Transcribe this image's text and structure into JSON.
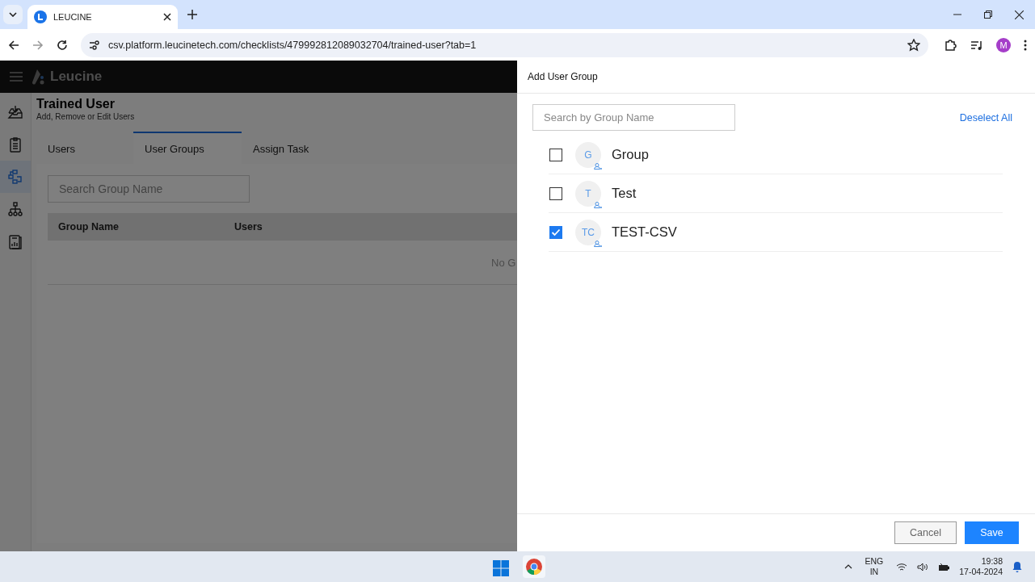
{
  "browser": {
    "tab_title": "LEUCINE",
    "url": "csv.platform.leucinetech.com/checklists/479992812089032704/trained-user?tab=1",
    "profile": "M"
  },
  "app": {
    "brand": "Leucine",
    "sidebar": [
      {
        "kind": "inbox",
        "selected": false
      },
      {
        "kind": "checklist",
        "selected": false
      },
      {
        "kind": "flow",
        "selected": true
      },
      {
        "kind": "hierarchy",
        "selected": false
      },
      {
        "kind": "report",
        "selected": false
      }
    ],
    "title": "Trained User",
    "subtitle": "Add, Remove or Edit Users",
    "tabs": [
      {
        "label": "Users",
        "selected": false
      },
      {
        "label": "User Groups",
        "selected": true
      },
      {
        "label": "Assign Task",
        "selected": false
      }
    ],
    "search": {
      "placeholder": "Search Group Name"
    },
    "table": {
      "columns": [
        "Group Name",
        "Users"
      ],
      "empty_text": "No G"
    }
  },
  "drawer": {
    "title": "Add User Group",
    "search": {
      "placeholder": "Search by Group Name"
    },
    "deselect": "Deselect All",
    "groups": [
      {
        "initials": "G",
        "name": "Group",
        "checked": false
      },
      {
        "initials": "T",
        "name": "Test",
        "checked": false
      },
      {
        "initials": "TC",
        "name": "TEST-CSV",
        "checked": true
      }
    ],
    "buttons": {
      "cancel": "Cancel",
      "save": "Save"
    }
  },
  "taskbar": {
    "language": "ENG",
    "region": "IN",
    "time": "19:38",
    "date": "17-04-2024"
  }
}
